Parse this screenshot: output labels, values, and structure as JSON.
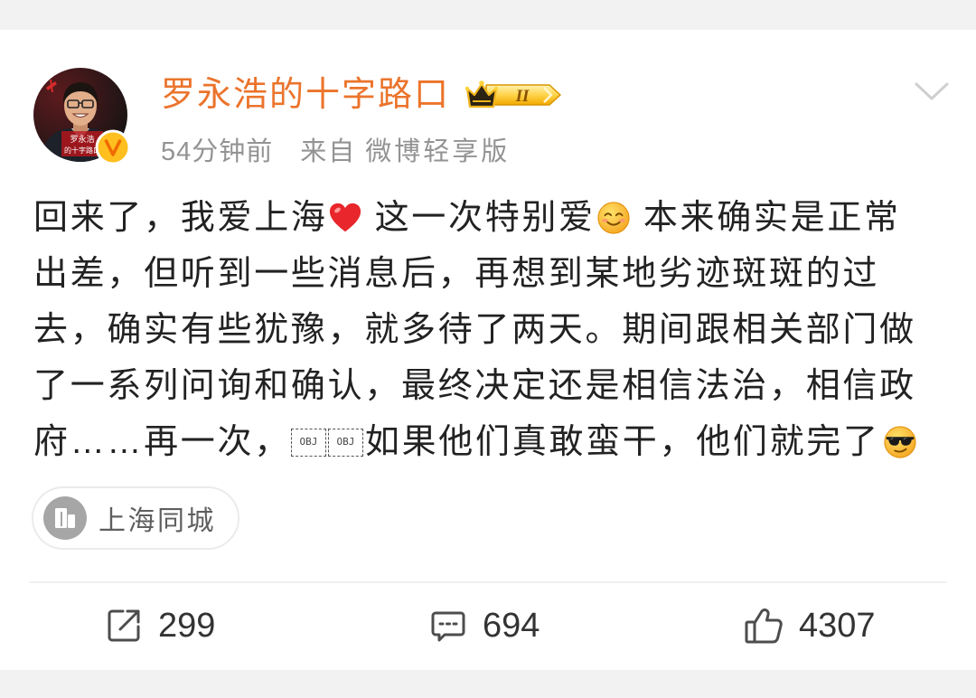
{
  "colors": {
    "page_background": "#f2f2f2",
    "card_background": "#ffffff",
    "author_name": "#eb742c",
    "body_text": "#222222",
    "meta_text": "#939393",
    "icon": "#4d4d4d",
    "verified_badge": "#ffbf1f"
  },
  "post": {
    "author": {
      "name": "罗永浩的十字路口",
      "avatar_caption": [
        "罗永浩",
        "的十字路口"
      ],
      "verified_icon": "gold-verified-v-icon",
      "level_badge": {
        "icon": "crown-level-badge-icon",
        "level": "II"
      }
    },
    "meta": {
      "time": "54分钟前",
      "source_label": "来自",
      "source": "微博轻享版"
    },
    "more_icon": "chevron-down-icon",
    "body_lines": [
      [
        {
          "text": "回来了，我爱上海"
        },
        {
          "emoji": "red-heart-emoji"
        },
        {
          "text": "这一次特别爱"
        },
        {
          "emoji": "smiling-face-emoji"
        },
        {
          "text": "本来确实是正常"
        }
      ],
      [
        {
          "text": "出差，但听到一些消息后，再想到某地劣迹斑斑的过"
        }
      ],
      [
        {
          "text": "去，确实有些犹豫，就多待了两天。期间跟相关部门做"
        }
      ],
      [
        {
          "text": "了一系列问询和确认，最终决定还是相信法治，相信政"
        }
      ],
      [
        {
          "text": "府……再一次，"
        },
        {
          "placeholder": "OBJ"
        },
        {
          "placeholder": "OBJ"
        },
        {
          "text": "如果他们真敢蛮干，他们就完了"
        },
        {
          "emoji": "sunglasses-face-emoji"
        }
      ]
    ],
    "location": {
      "icon": "building-icon",
      "label": "上海同城"
    },
    "actions": [
      {
        "icon": "share-icon",
        "count": "299"
      },
      {
        "icon": "comment-icon",
        "count": "694"
      },
      {
        "icon": "like-icon",
        "count": "4307"
      }
    ]
  }
}
